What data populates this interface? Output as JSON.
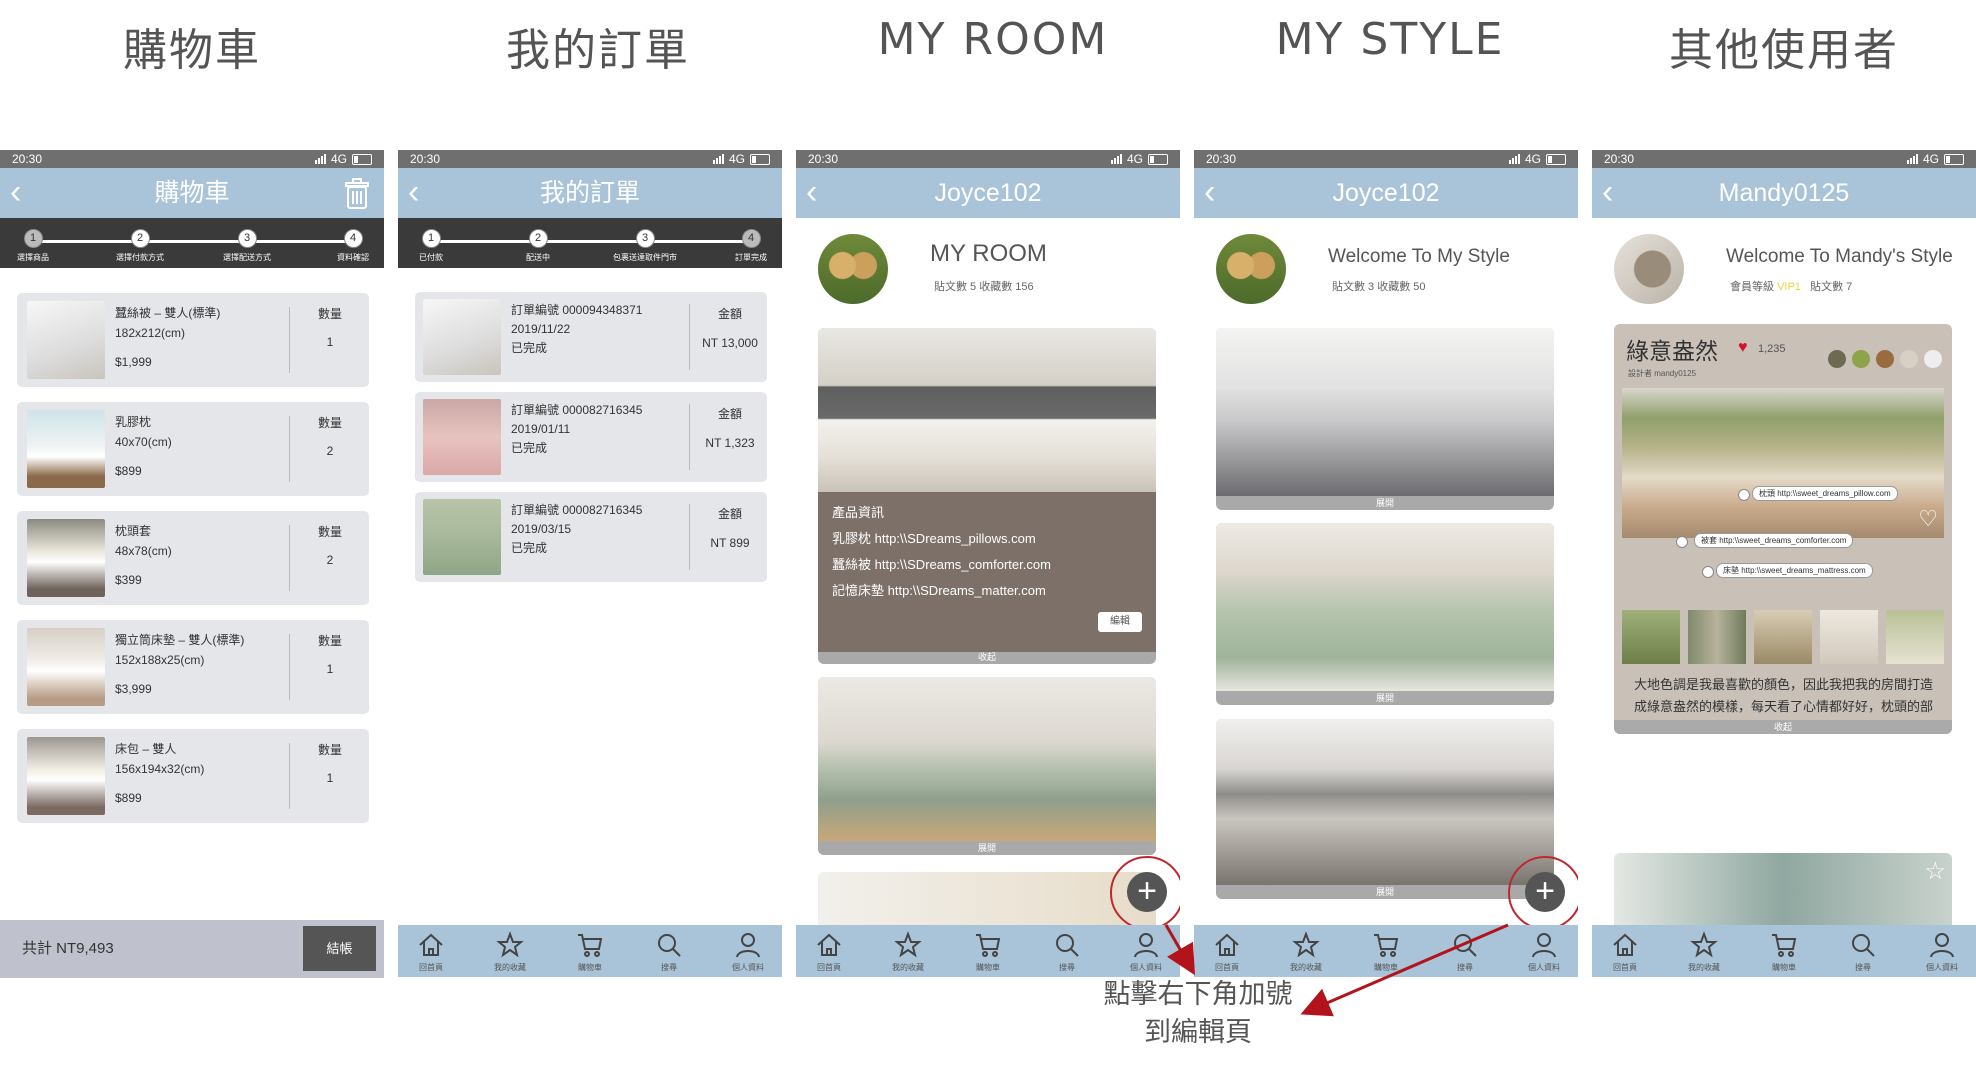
{
  "titles": {
    "cart": "購物車",
    "orders": "我的訂單",
    "room": "MY ROOM",
    "style": "MY STYLE",
    "others": "其他使用者"
  },
  "status": {
    "time": "20:30",
    "network": "4G"
  },
  "tabs": [
    "回首頁",
    "我的收藏",
    "購物車",
    "搜尋",
    "個人資料"
  ],
  "cart": {
    "header": "購物車",
    "steps": [
      "選擇商品",
      "選擇付款方式",
      "選擇配送方式",
      "資料確認"
    ],
    "qty_label": "數量",
    "items": [
      {
        "name": "蠶絲被 – 雙人(標準)",
        "size": "182x212(cm)",
        "price": "$1,999",
        "qty": "1"
      },
      {
        "name": "乳膠枕",
        "size": "40x70(cm)",
        "price": "$899",
        "qty": "2"
      },
      {
        "name": "枕頭套",
        "size": "48x78(cm)",
        "price": "$399",
        "qty": "2"
      },
      {
        "name": "獨立筒床墊 – 雙人(標準)",
        "size": "152x188x25(cm)",
        "price": "$3,999",
        "qty": "1"
      },
      {
        "name": "床包 – 雙人",
        "size": "156x194x32(cm)",
        "price": "$899",
        "qty": "1"
      }
    ],
    "total": "共計 NT9,493",
    "checkout": "結帳"
  },
  "orders": {
    "header": "我的訂單",
    "steps": [
      "已付款",
      "配送中",
      "包裹送達取件門市",
      "訂單完成"
    ],
    "amount_label": "金額",
    "items": [
      {
        "number": "訂單編號 000094348371",
        "date": "2019/11/22",
        "status": "已完成",
        "amount": "NT 13,000"
      },
      {
        "number": "訂單編號 000082716345",
        "date": "2019/01/11",
        "status": "已完成",
        "amount": "NT 1,323"
      },
      {
        "number": "訂單編號 000082716345",
        "date": "2019/03/15",
        "status": "已完成",
        "amount": "NT 899"
      }
    ]
  },
  "room": {
    "header": "Joyce102",
    "title": "MY ROOM",
    "stats": "貼文數 5   收藏數 156",
    "info_title": "產品資訊",
    "links": [
      "乳膠枕 http:\\\\SDreams_pillows.com",
      "蠶絲被 http:\\\\SDreams_comforter.com",
      "記憶床墊 http:\\\\SDreams_matter.com"
    ],
    "edit": "編輯",
    "collapse": "收起",
    "expand": "展開"
  },
  "style": {
    "header": "Joyce102",
    "title": "Welcome To My Style",
    "stats": "貼文數 3   收藏數 50",
    "expand": "展開"
  },
  "others": {
    "header": "Mandy0125",
    "title": "Welcome To Mandy's Style",
    "level_label": "會員等級",
    "level": "VIP1",
    "posts": "貼文數 7",
    "post_title": "綠意盎然",
    "likes": "1,235",
    "designer": "設計者 mandy0125",
    "swatches": [
      "#6e6a52",
      "#8fa34a",
      "#9a6b3c",
      "#d8d0c4",
      "#eeeeee"
    ],
    "tags": [
      "枕頭 http:\\\\sweet_dreams_pillow.com",
      "被套 http:\\\\sweet_dreams_comforter.com",
      "床墊 http:\\\\sweet_dreams_mattress.com"
    ],
    "description": "大地色調是我最喜歡的顏色，因此我把我的房間打造成綠意盎然的模樣，每天看了心情都好好，枕頭的部分是ｘｘｘ家的棉花枕，棉被是Ｓ家羽絨被蓋起來很舒適，床墊也是Ｓ家的記憶床墊，大推Ｓ家！！希望大家喜歡我的設計，有興趣也歡迎多多交流喔～",
    "collapse": "收起"
  },
  "annotation": "點擊右下角加號到編輯頁"
}
